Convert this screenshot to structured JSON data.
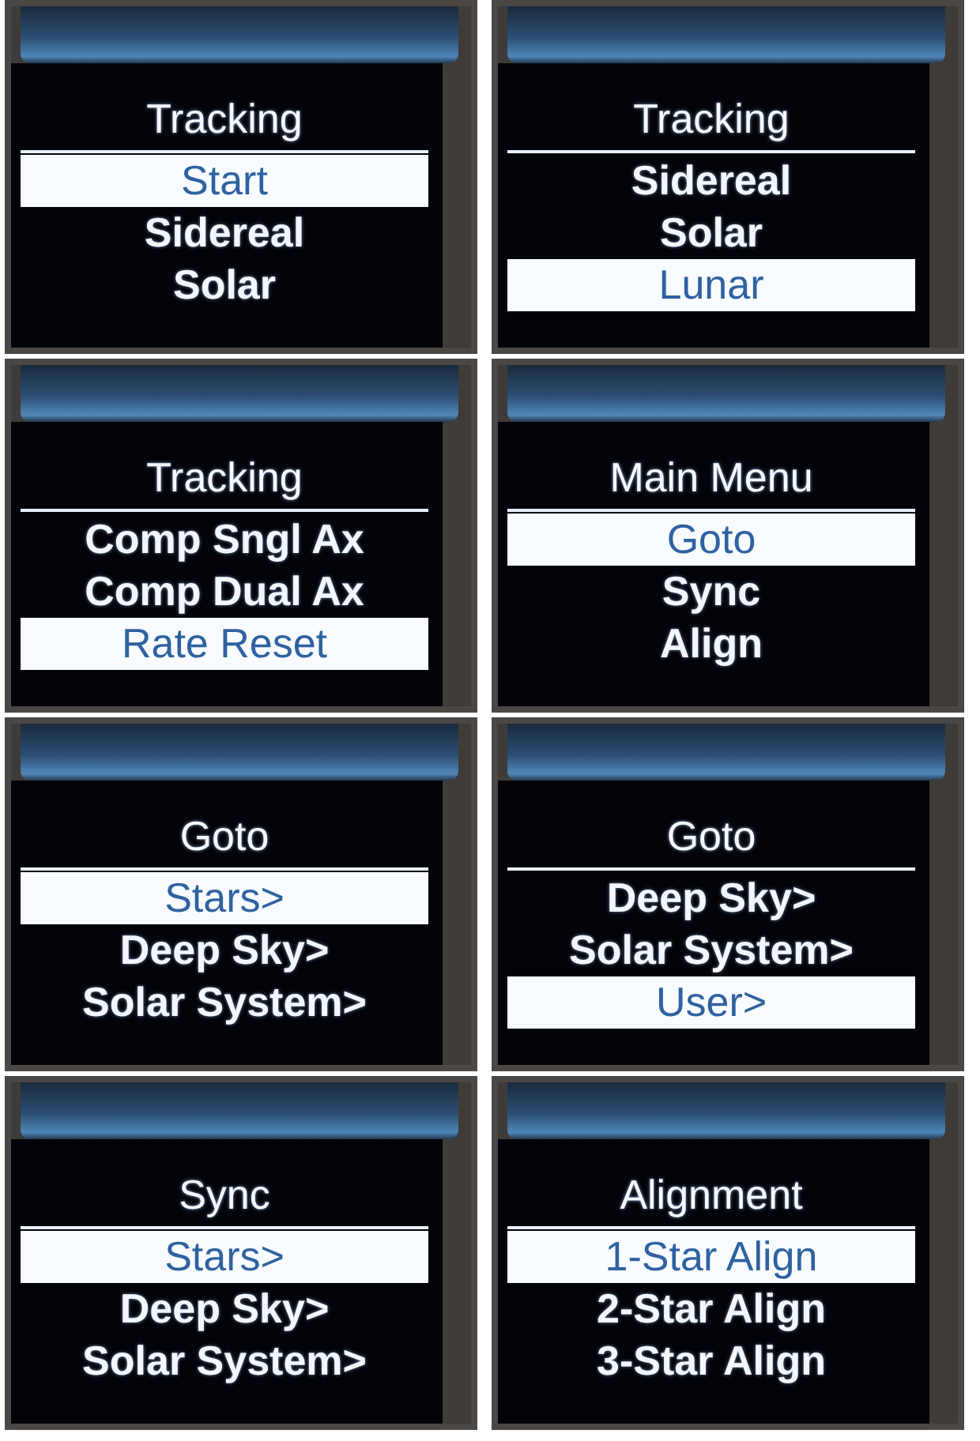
{
  "screens": [
    {
      "title": "Tracking",
      "items": [
        {
          "label": "Start",
          "selected": true
        },
        {
          "label": "Sidereal",
          "selected": false
        },
        {
          "label": "Solar",
          "selected": false
        }
      ]
    },
    {
      "title": "Tracking",
      "items": [
        {
          "label": "Sidereal",
          "selected": false
        },
        {
          "label": "Solar",
          "selected": false
        },
        {
          "label": "Lunar",
          "selected": true
        }
      ]
    },
    {
      "title": "Tracking",
      "items": [
        {
          "label": "Comp Sngl Ax",
          "selected": false
        },
        {
          "label": "Comp Dual Ax",
          "selected": false
        },
        {
          "label": "Rate Reset",
          "selected": true
        }
      ]
    },
    {
      "title": "Main Menu",
      "items": [
        {
          "label": "Goto",
          "selected": true
        },
        {
          "label": "Sync",
          "selected": false
        },
        {
          "label": "Align",
          "selected": false
        }
      ]
    },
    {
      "title": "Goto",
      "items": [
        {
          "label": "Stars>",
          "selected": true
        },
        {
          "label": "Deep Sky>",
          "selected": false
        },
        {
          "label": "Solar System>",
          "selected": false
        }
      ]
    },
    {
      "title": "Goto",
      "items": [
        {
          "label": "Deep Sky>",
          "selected": false
        },
        {
          "label": "Solar System>",
          "selected": false
        },
        {
          "label": "User>",
          "selected": true
        }
      ]
    },
    {
      "title": "Sync",
      "items": [
        {
          "label": "Stars>",
          "selected": true
        },
        {
          "label": "Deep Sky>",
          "selected": false
        },
        {
          "label": "Solar System>",
          "selected": false
        }
      ]
    },
    {
      "title": "Alignment",
      "items": [
        {
          "label": "1-Star Align",
          "selected": true
        },
        {
          "label": "2-Star Align",
          "selected": false
        },
        {
          "label": "3-Star Align",
          "selected": false
        }
      ]
    }
  ]
}
